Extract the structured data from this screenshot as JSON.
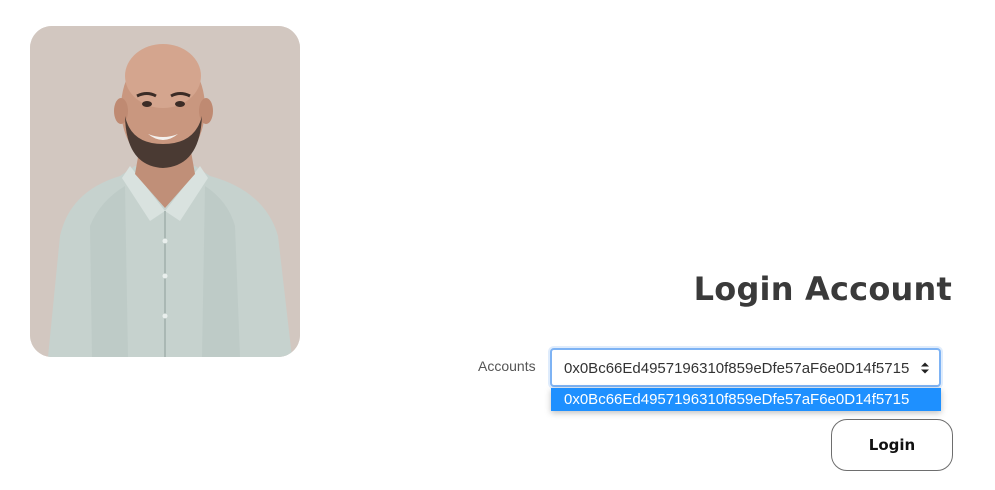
{
  "login": {
    "title": "Login Account",
    "accounts_label": "Accounts",
    "selected_account": "0x0Bc66Ed4957196310f859eDfe57aF6e0D14f5715",
    "options": [
      "0x0Bc66Ed4957196310f859eDfe57aF6e0D14f5715"
    ],
    "login_button": "Login"
  },
  "colors": {
    "photo_background": "#d2c7c0",
    "option_highlight": "#1e90ff",
    "focus_border": "#7eb3f4",
    "title_text": "#3a3a3a"
  }
}
